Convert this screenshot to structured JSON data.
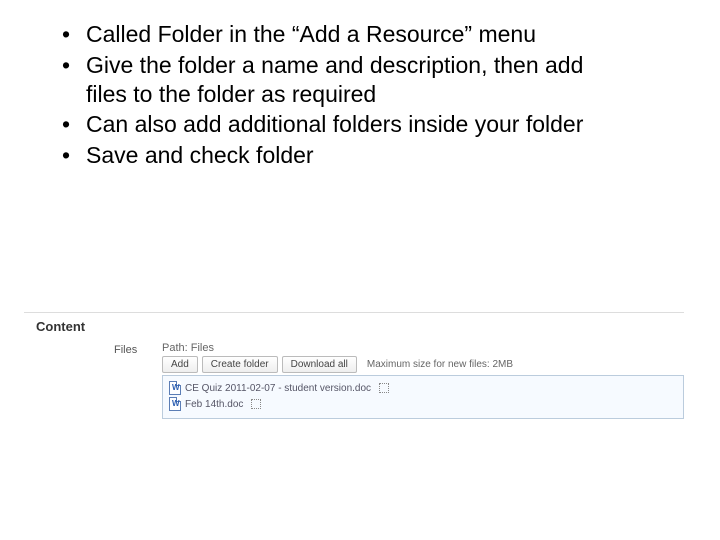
{
  "bullets": [
    "Called Folder in the “Add a Resource” menu",
    "Give the folder a name and description, then add files to the folder as required",
    "Can also add additional folders inside your folder",
    "Save and check folder"
  ],
  "section_title": "Content",
  "form": {
    "label": "Files",
    "path": "Path:  Files",
    "buttons": {
      "add": "Add",
      "create_folder": "Create folder",
      "download_all": "Download all"
    },
    "hint": "Maximum size for new files: 2MB",
    "files": [
      "CE Quiz 2011-02-07 - student version.doc",
      "Feb 14th.doc"
    ]
  }
}
